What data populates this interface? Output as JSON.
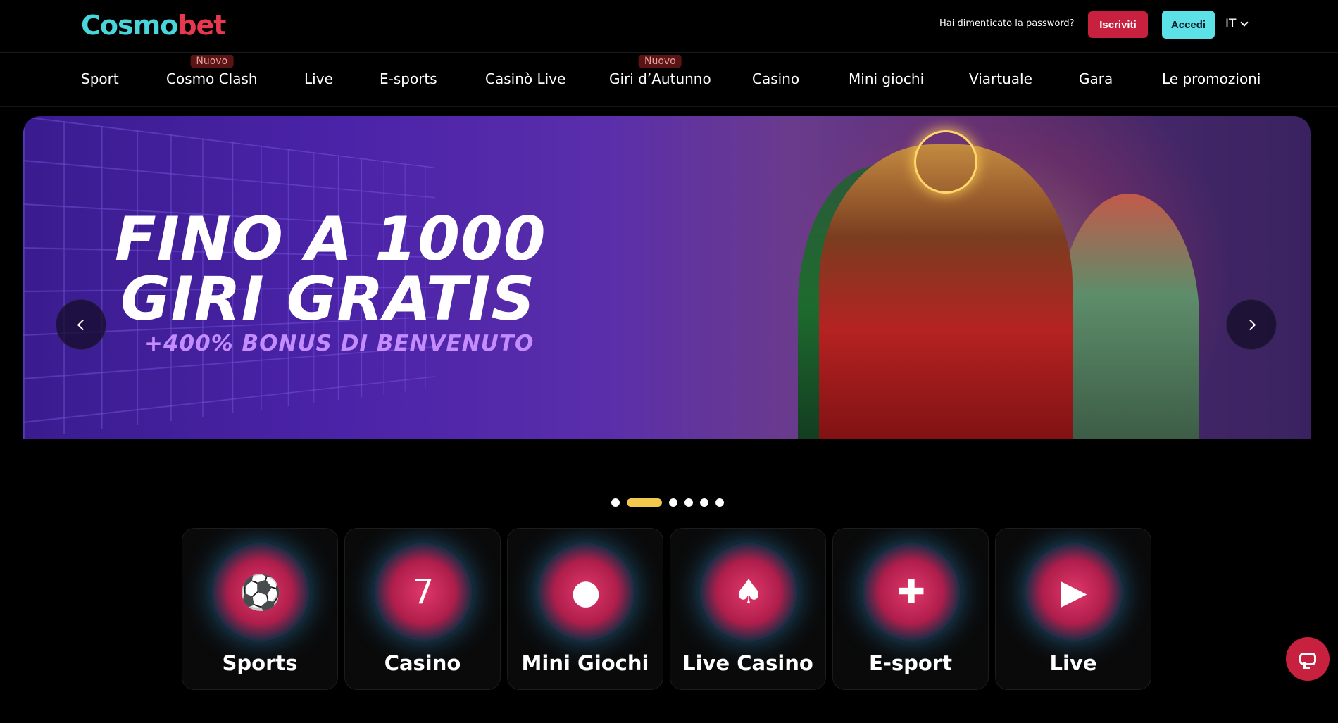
{
  "header": {
    "logo_part1": "Cosmo",
    "logo_part2": "bet",
    "forgot_password": "Hai dimenticato la password?",
    "register_label": "Iscriviti",
    "login_label": "Accedi",
    "language": "IT",
    "colors": {
      "register": "#c7213f",
      "login": "#5ce1e6"
    }
  },
  "nav": {
    "items": [
      {
        "label": "Sport"
      },
      {
        "label": "Cosmo Clash",
        "badge": "Nuovo"
      },
      {
        "label": "Live"
      },
      {
        "label": "E-sports"
      },
      {
        "label": "Casinò Live"
      },
      {
        "label": "Giri d’Autunno",
        "badge": "Nuovo"
      },
      {
        "label": "Casino"
      },
      {
        "label": "Mini giochi"
      },
      {
        "label": "Viartuale"
      },
      {
        "label": "Gara"
      },
      {
        "label": "Le promozioni"
      }
    ]
  },
  "banner": {
    "line1": "FINO A 1000",
    "line2": "GIRI GRATIS",
    "subtitle": "+400% BONUS DI BENVENUTO",
    "slide_count": 6,
    "active_slide": 2
  },
  "categories": [
    {
      "label": "Sports",
      "icon": "stadium-ball-icon"
    },
    {
      "label": "Casino",
      "icon": "slot-machine-icon"
    },
    {
      "label": "Mini Giochi",
      "icon": "joystick-icon"
    },
    {
      "label": "Live Casino",
      "icon": "cards-chip-icon"
    },
    {
      "label": "E-sport",
      "icon": "gamepad-icon"
    },
    {
      "label": "Live",
      "icon": "live-tv-icon"
    }
  ]
}
